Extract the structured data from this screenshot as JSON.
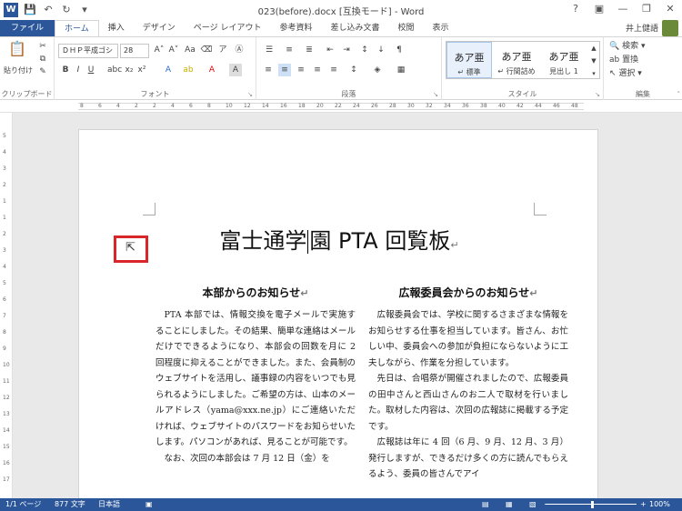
{
  "app": {
    "title": "023(before).docx [互換モード] - Word",
    "word_icon": "W",
    "user": "井上健語"
  },
  "qat": [
    "save-icon",
    "undo-icon",
    "redo-icon",
    "customize-icon"
  ],
  "tabs": [
    "ファイル",
    "ホーム",
    "挿入",
    "デザイン",
    "ページ レイアウト",
    "参考資料",
    "差し込み文書",
    "校閲",
    "表示"
  ],
  "ribbon": {
    "clipboard": {
      "paste": "貼り付け",
      "label": "クリップボード"
    },
    "font": {
      "name": "ＤＨＰ平成ゴシ",
      "size": "28",
      "label": "フォント"
    },
    "paragraph": {
      "label": "段落"
    },
    "styles": {
      "label": "スタイル",
      "items": [
        {
          "sample": "あア亜",
          "name": "↵ 標準"
        },
        {
          "sample": "あア亜",
          "name": "↵ 行間詰め"
        },
        {
          "sample": "あア亜",
          "name": "見出し 1"
        }
      ]
    },
    "editing": {
      "search": "検索",
      "replace": "置換",
      "select": "選択",
      "label": "編集"
    }
  },
  "ruler": {
    "h": [
      "8",
      "6",
      "4",
      "2",
      "2",
      "4",
      "6",
      "8",
      "10",
      "12",
      "14",
      "16",
      "18",
      "20",
      "22",
      "24",
      "26",
      "28",
      "30",
      "32",
      "34",
      "36",
      "38",
      "40",
      "42",
      "44",
      "46",
      "48"
    ],
    "v": [
      "5",
      "4",
      "3",
      "2",
      "1",
      "1",
      "2",
      "3",
      "4",
      "5",
      "6",
      "7",
      "8",
      "9",
      "10",
      "11",
      "12",
      "13",
      "14",
      "15",
      "16",
      "17"
    ]
  },
  "document": {
    "title_before": "富士通学",
    "title_after": "園 PTA 回覧板",
    "col1": {
      "heading": "本部からのお知らせ",
      "paragraphs": [
        "PTA 本部では、情報交換を電子メールで実施することにしました。その結果、簡単な連絡はメールだけでできるようになり、本部会の回数を月に 2 回程度に抑えることができました。また、会員制のウェブサイトを活用し、議事録の内容をいつでも見られるようにしました。ご希望の方は、山本のメールアドレス（yama@xxx.ne.jp）にご連絡いただければ、ウェブサイトのパスワードをお知らせいたします。パソコンがあれば、見ることが可能です。",
        "なお、次回の本部会は 7 月 12 日（金）を"
      ]
    },
    "col2": {
      "heading": "広報委員会からのお知らせ",
      "paragraphs": [
        "広報委員会では、学校に関するさまざまな情報をお知らせする仕事を担当しています。皆さん、お忙しい中、委員会への参加が負担にならないように工夫しながら、作業を分担しています。",
        "先日は、合唱祭が開催されましたので、広報委員の田中さんと西山さんのお二人で取材を行いました。取材した内容は、次回の広報誌に掲載する予定です。",
        "広報誌は年に 4 回（6 月、9 月、12 月、3 月）発行しますが、できるだけ多くの方に読んでもらえるよう、委員の皆さんでアイ"
      ]
    },
    "pilcrow": "↵"
  },
  "status": {
    "page": "1/1 ページ",
    "words": "877 文字",
    "lang": "日本語",
    "zoom": "100%"
  }
}
